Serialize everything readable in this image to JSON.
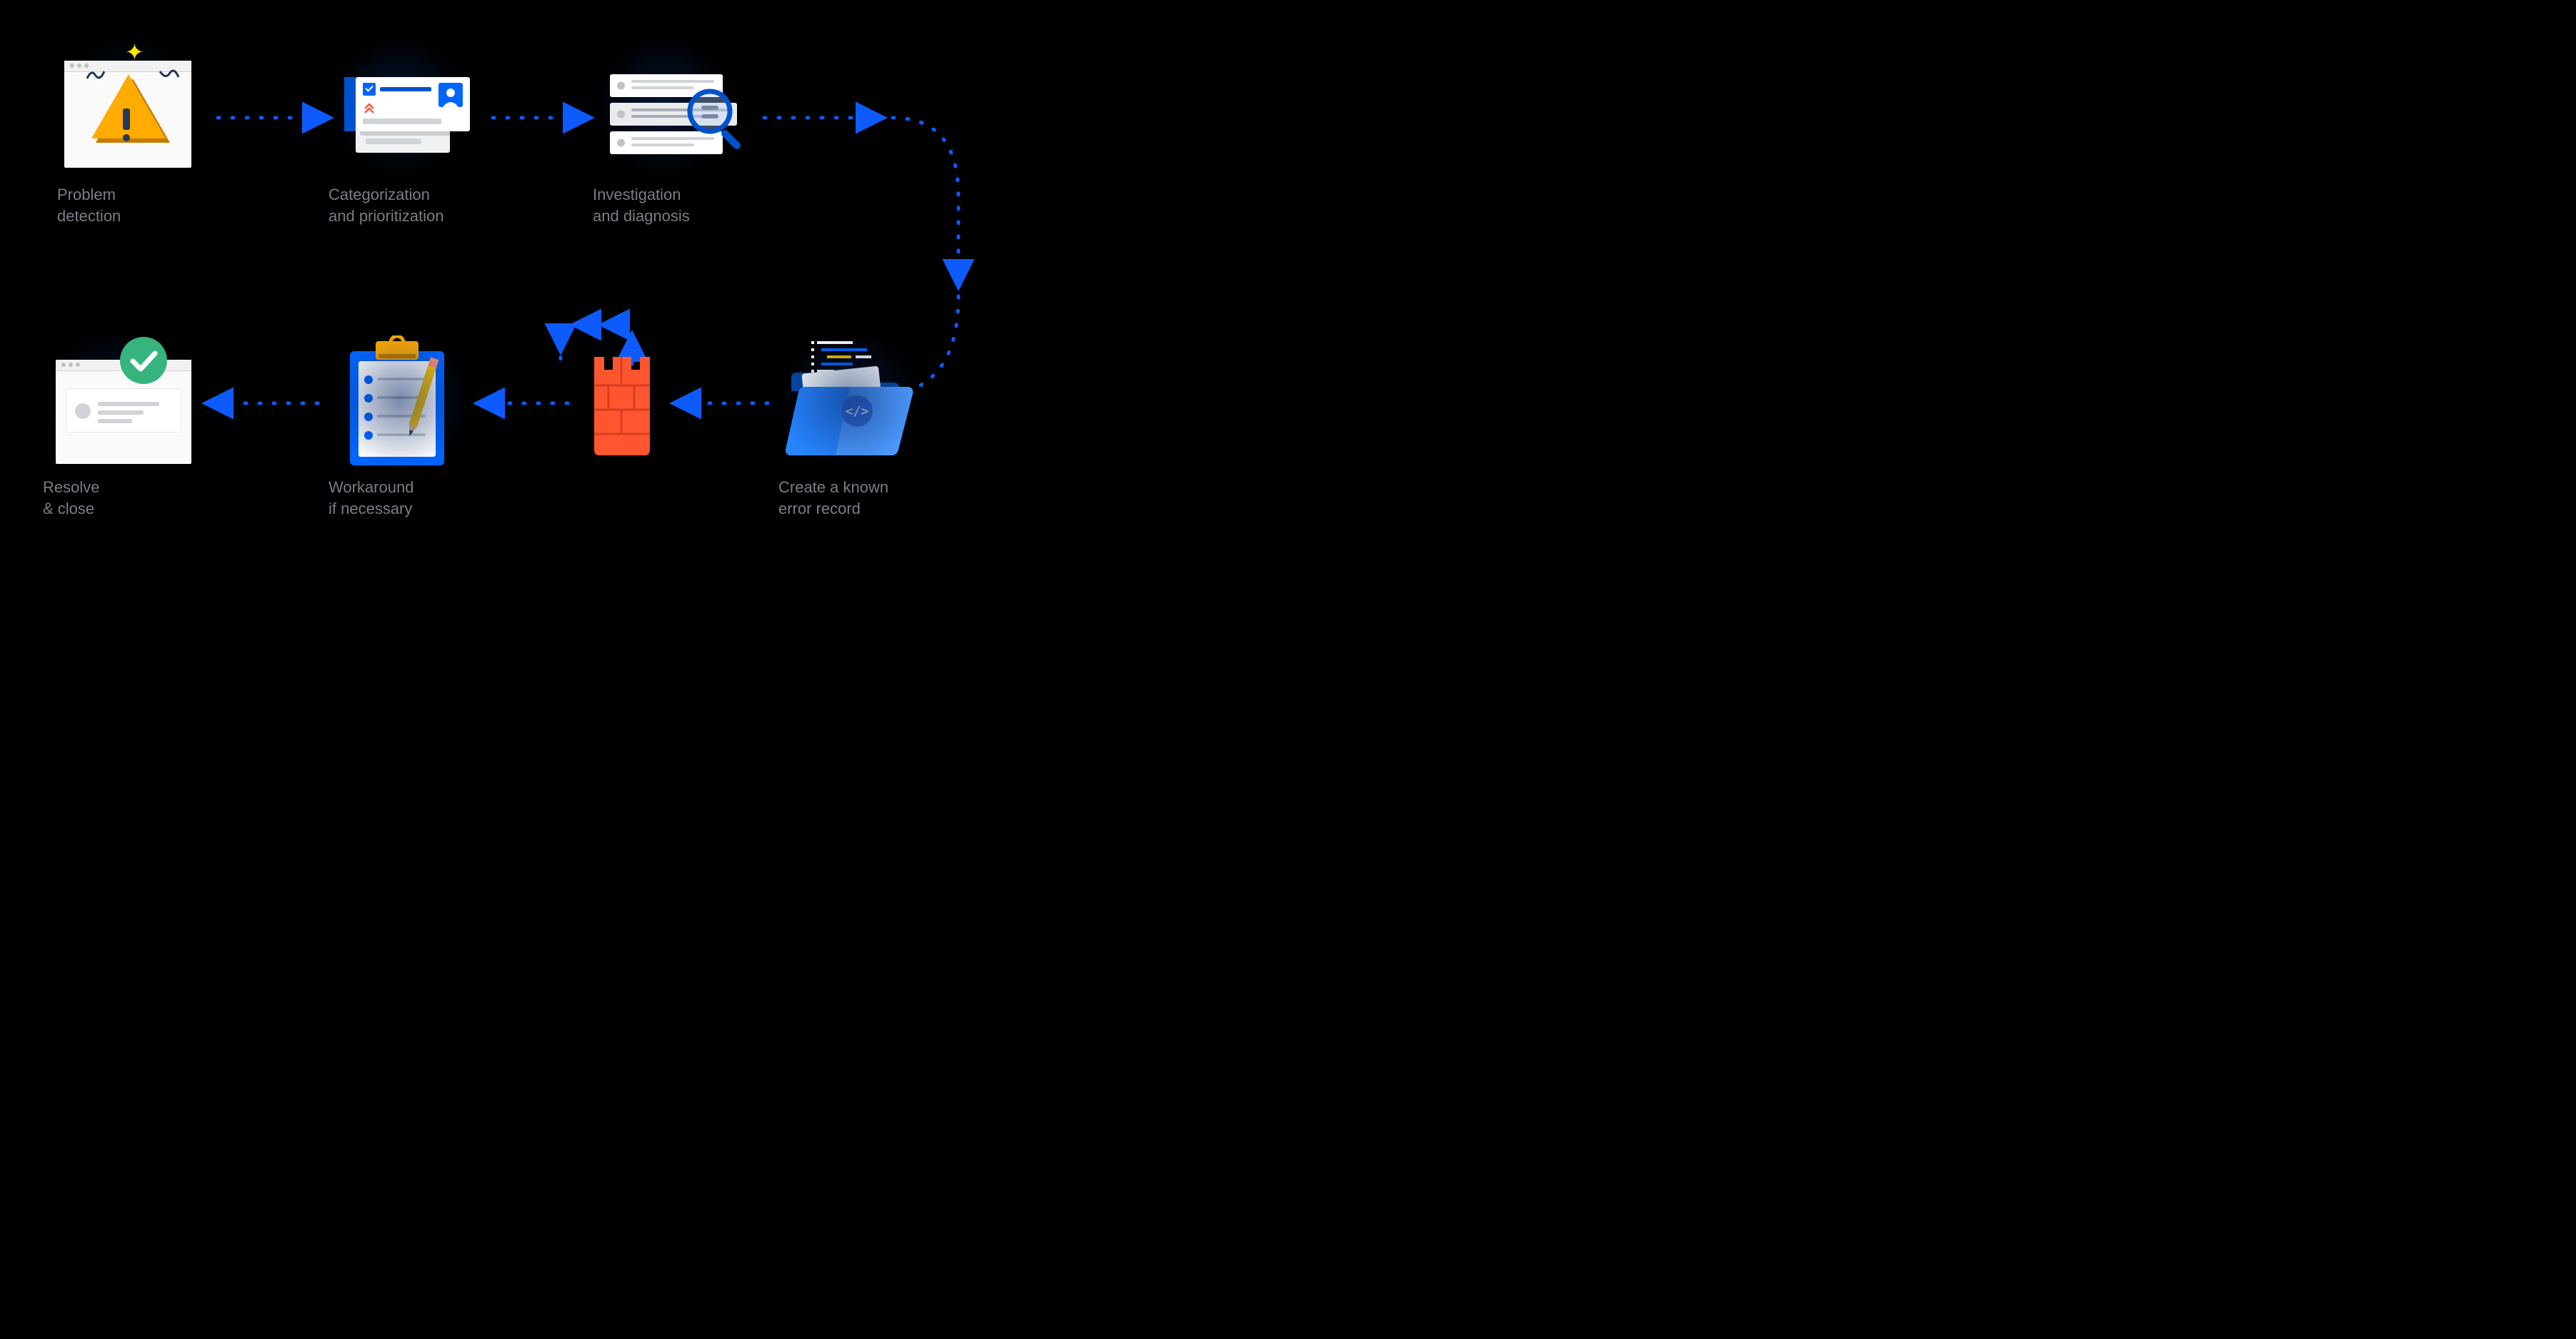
{
  "steps": {
    "s1": {
      "label_l1": "Problem",
      "label_l2": "detection",
      "icon": "problem-detection"
    },
    "s2": {
      "label_l1": "Categorization",
      "label_l2": "and prioritization",
      "icon": "categorization-prioritization"
    },
    "s3": {
      "label_l1": "Investigation",
      "label_l2": "and diagnosis",
      "icon": "investigation-diagnosis"
    },
    "s4": {
      "label_l1": "Create a known",
      "label_l2": "error record",
      "icon": "known-error-record"
    },
    "s5": {
      "label_l1": "Workaround",
      "label_l2": "if necessary",
      "icon": "workaround"
    },
    "s6": {
      "label_l1": "Resolve",
      "label_l2": "& close",
      "icon": "resolve-close"
    }
  },
  "flow_order": [
    "s1",
    "s2",
    "s3",
    "s4",
    "s5",
    "s6"
  ],
  "connector_style": {
    "color": "#0d5bff",
    "dash": "dotted",
    "arrowhead": "triangle"
  }
}
